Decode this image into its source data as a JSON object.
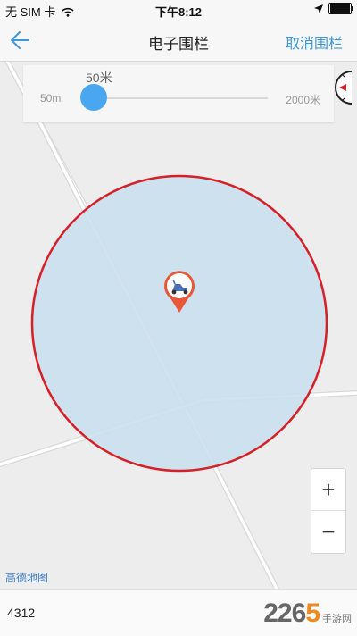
{
  "status_bar": {
    "carrier": "无 SIM 卡",
    "time": "下午8:12"
  },
  "nav": {
    "title": "电子围栏",
    "right_action": "取消围栏"
  },
  "radius_slider": {
    "current_label": "50米",
    "min_label": "50m",
    "max_label": "2000米",
    "value": 50,
    "min": 50,
    "max": 2000
  },
  "map": {
    "provider_logo": "高德地图",
    "fence_color": "#d61f26",
    "fill_color": "#c9dfee",
    "marker_icon": "scooter-icon"
  },
  "zoom": {
    "in": "+",
    "out": "−"
  },
  "bottom": {
    "text": "4312"
  },
  "watermark": {
    "number": "2265",
    "site": "手游网",
    "accent": "#ef8a1d"
  },
  "colors": {
    "accent": "#3e97d6",
    "slider": "#49a6ef"
  }
}
